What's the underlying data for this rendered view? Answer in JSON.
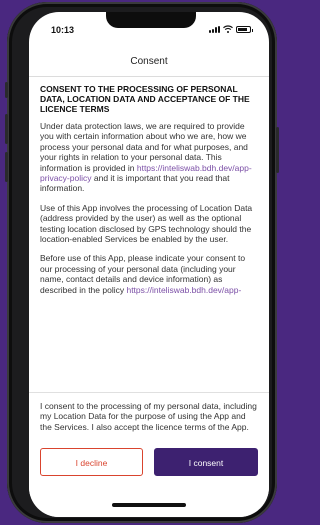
{
  "status_bar": {
    "time": "10:13"
  },
  "nav": {
    "title": "Consent"
  },
  "document": {
    "heading": "CONSENT TO THE PROCESSING OF PERSONAL DATA, LOCATION DATA AND ACCEPTANCE OF THE LICENCE TERMS",
    "para1_text": "Under data protection laws, we are required to provide you with certain information about who we are, how we process your personal data and for what purposes, and your rights in relation to your personal data. This information is provided in ",
    "para1_link": "https://inteliswab.bdh.dev/app-privacy-policy",
    "para1_tail": " and it is important that you read that information.",
    "para2_text": "Use of this App involves the processing of Location Data (address provided by the user) as well as the optional testing location disclosed by GPS technology should the location-enabled Services be enabled by the user.",
    "para3_text": "Before use of this App, please indicate your consent to our processing of your personal data (including your name, contact details and device information) as described in the policy ",
    "para3_link": "https://inteliswab.bdh.dev/app-"
  },
  "consent_statement": "I consent to the processing of my personal data, including my Location Data for the purpose of using the App and the Services. I also accept the licence terms of the App.",
  "buttons": {
    "decline": "I decline",
    "consent": "I consent"
  },
  "colors": {
    "background": "#4a2880",
    "accent": "#3d2170",
    "decline": "#d9442e",
    "link": "#7b4fa6"
  }
}
